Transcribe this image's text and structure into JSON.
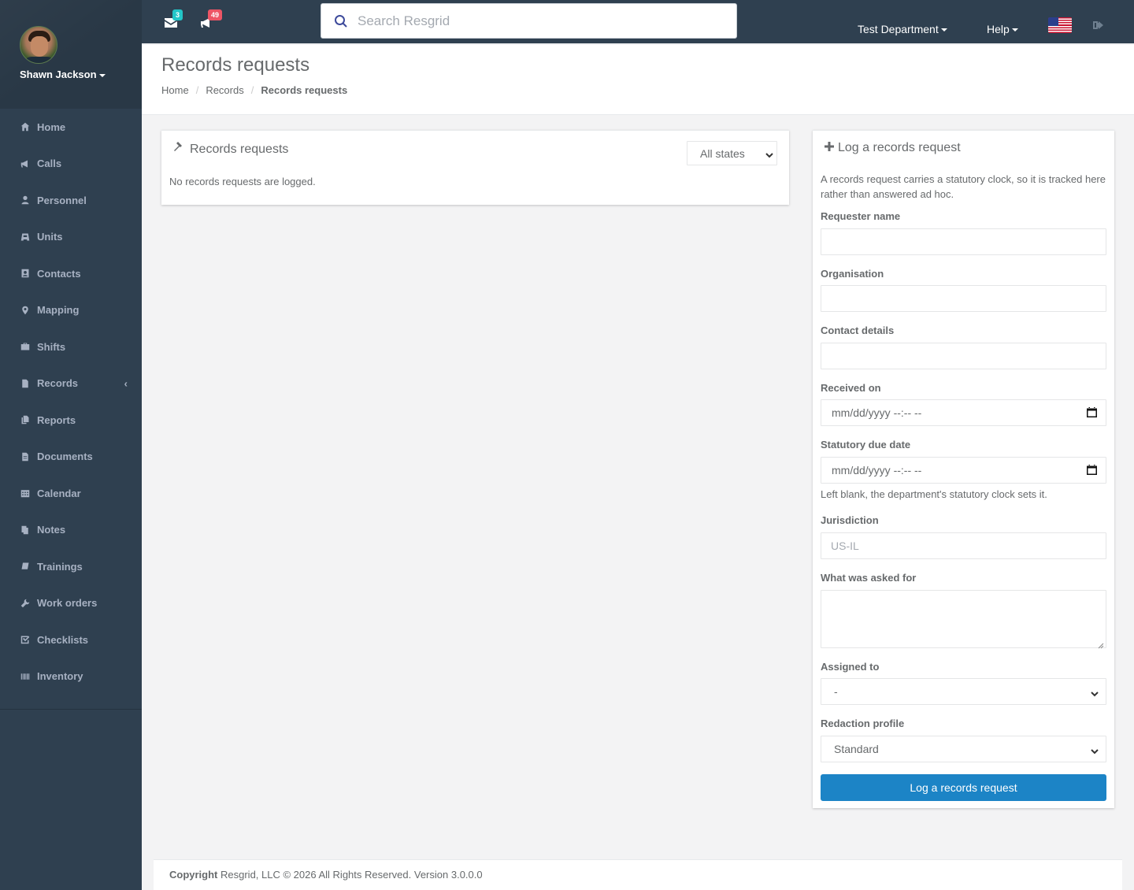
{
  "user": {
    "name": "Shawn Jackson"
  },
  "sidebar": {
    "items": [
      {
        "label": "Home",
        "icon": "home-icon"
      },
      {
        "label": "Calls",
        "icon": "bullhorn-icon"
      },
      {
        "label": "Personnel",
        "icon": "user-icon"
      },
      {
        "label": "Units",
        "icon": "truck-icon"
      },
      {
        "label": "Contacts",
        "icon": "contact-card-icon"
      },
      {
        "label": "Mapping",
        "icon": "map-marker-icon"
      },
      {
        "label": "Shifts",
        "icon": "briefcase-icon"
      },
      {
        "label": "Records",
        "icon": "file-icon"
      },
      {
        "label": "Reports",
        "icon": "copy-icon"
      },
      {
        "label": "Documents",
        "icon": "document-icon"
      },
      {
        "label": "Calendar",
        "icon": "calendar-icon"
      },
      {
        "label": "Notes",
        "icon": "notes-icon"
      },
      {
        "label": "Trainings",
        "icon": "book-icon"
      },
      {
        "label": "Work orders",
        "icon": "wrench-icon"
      },
      {
        "label": "Checklists",
        "icon": "check-square-icon"
      },
      {
        "label": "Inventory",
        "icon": "barcode-icon"
      }
    ]
  },
  "topbar": {
    "messages_count": "3",
    "calls_count": "49",
    "search_placeholder": "Search Resgrid",
    "department": "Test Department",
    "help": "Help"
  },
  "heading": {
    "title": "Records requests",
    "breadcrumb": [
      "Home",
      "Records",
      "Records requests"
    ]
  },
  "requests_panel": {
    "title": "Records requests",
    "state_filter": "All states",
    "empty": "No records requests are logged."
  },
  "form": {
    "title": "Log a records request",
    "intro": "A records request carries a statutory clock, so it is tracked here rather than answered ad hoc.",
    "requester_label": "Requester name",
    "organisation_label": "Organisation",
    "contact_label": "Contact details",
    "received_label": "Received on",
    "received_value": "mm/dd/yyyy  --:-- --",
    "due_label": "Statutory due date",
    "due_value": "mm/dd/yyyy  --:-- --",
    "due_help": "Left blank, the department's statutory clock sets it.",
    "jurisdiction_label": "Jurisdiction",
    "jurisdiction_placeholder": "US-IL",
    "asked_label": "What was asked for",
    "assigned_label": "Assigned to",
    "assigned_value": "-",
    "redaction_label": "Redaction profile",
    "redaction_value": "Standard",
    "submit_label": "Log a records request"
  },
  "footer": {
    "copyright": "Copyright",
    "text": " Resgrid, LLC © 2026 All Rights Reserved.",
    "version": " Version 3.0.0.0"
  },
  "colors": {
    "sidebar": "#2f4050",
    "primary_button": "#1c84c6",
    "badge_messages": "#23c6c8",
    "badge_calls": "#ed5565"
  }
}
